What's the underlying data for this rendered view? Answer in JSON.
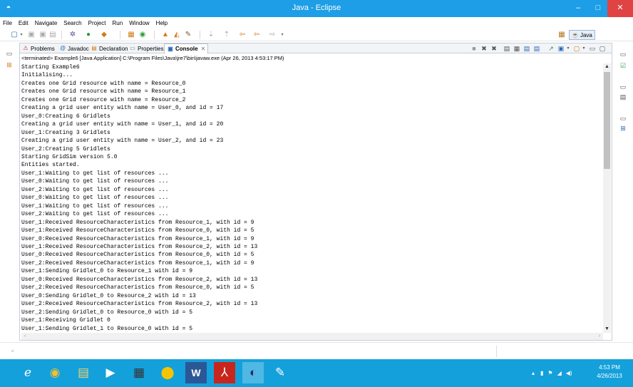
{
  "window": {
    "title": "Java - Eclipse",
    "app_icon": "eclipse-icon",
    "minimize": "–",
    "maximize": "□",
    "close": "✕"
  },
  "menu": [
    "File",
    "Edit",
    "Navigate",
    "Search",
    "Project",
    "Run",
    "Window",
    "Help"
  ],
  "perspective": {
    "label": "Java",
    "open_icon": "open-perspective-icon"
  },
  "tabs": [
    {
      "label": "Problems",
      "icon": "problems-icon"
    },
    {
      "label": "Javadoc",
      "icon": "javadoc-icon"
    },
    {
      "label": "Declaration",
      "icon": "declaration-icon"
    },
    {
      "label": "Properties",
      "icon": "properties-icon"
    },
    {
      "label": "Console",
      "icon": "console-icon",
      "active": true
    }
  ],
  "console": {
    "header": "<terminated> Example6 [Java Application] C:\\Program Files\\Java\\jre7\\bin\\javaw.exe (Apr 26, 2013 4:53:17 PM)",
    "lines": [
      "Starting Example6",
      "Initialising...",
      "Creates one Grid resource with name = Resource_0",
      "Creates one Grid resource with name = Resource_1",
      "Creates one Grid resource with name = Resource_2",
      "Creating a grid user entity with name = User_0, and id = 17",
      "User_0:Creating 6 Gridlets",
      "Creating a grid user entity with name = User_1, and id = 20",
      "User_1:Creating 3 Gridlets",
      "Creating a grid user entity with name = User_2, and id = 23",
      "User_2:Creating 5 Gridlets",
      "Starting GridSim version 5.0",
      "Entities started.",
      "User_1:Waiting to get list of resources ...",
      "User_0:Waiting to get list of resources ...",
      "User_2:Waiting to get list of resources ...",
      "User_0:Waiting to get list of resources ...",
      "User_1:Waiting to get list of resources ...",
      "User_2:Waiting to get list of resources ...",
      "User_1:Received ResourceCharacteristics from Resource_1, with id = 9",
      "User_1:Received ResourceCharacteristics from Resource_0, with id = 5",
      "User_0:Received ResourceCharacteristics from Resource_1, with id = 9",
      "User_1:Received ResourceCharacteristics from Resource_2, with id = 13",
      "User_0:Received ResourceCharacteristics from Resource_0, with id = 5",
      "User_2:Received ResourceCharacteristics from Resource_1, with id = 9",
      "User_1:Sending Gridlet_0 to Resource_1 with id = 9",
      "User_0:Received ResourceCharacteristics from Resource_2, with id = 13",
      "User_2:Received ResourceCharacteristics from Resource_0, with id = 5",
      "User_0:Sending Gridlet_0 to Resource_2 with id = 13",
      "User_2:Received ResourceCharacteristics from Resource_2, with id = 13",
      "User_2:Sending Gridlet_0 to Resource_0 with id = 5",
      "User_1:Receiving Gridlet 0",
      "User_1:Sending Gridlet_1 to Resource_0 with id = 5"
    ]
  },
  "taskbar": {
    "apps": [
      {
        "name": "internet-explorer",
        "glyph": "e"
      },
      {
        "name": "chrome",
        "glyph": "◉"
      },
      {
        "name": "file-explorer",
        "glyph": "▤"
      },
      {
        "name": "media-player",
        "glyph": "▶"
      },
      {
        "name": "calculator",
        "glyph": "▦"
      },
      {
        "name": "app-yellow",
        "glyph": "⬤"
      },
      {
        "name": "word",
        "glyph": "W"
      },
      {
        "name": "acrobat",
        "glyph": "⅄"
      },
      {
        "name": "eclipse",
        "glyph": "◐"
      },
      {
        "name": "paint",
        "glyph": "✎"
      }
    ],
    "time": "4:53 PM",
    "date": "4/26/2013"
  }
}
